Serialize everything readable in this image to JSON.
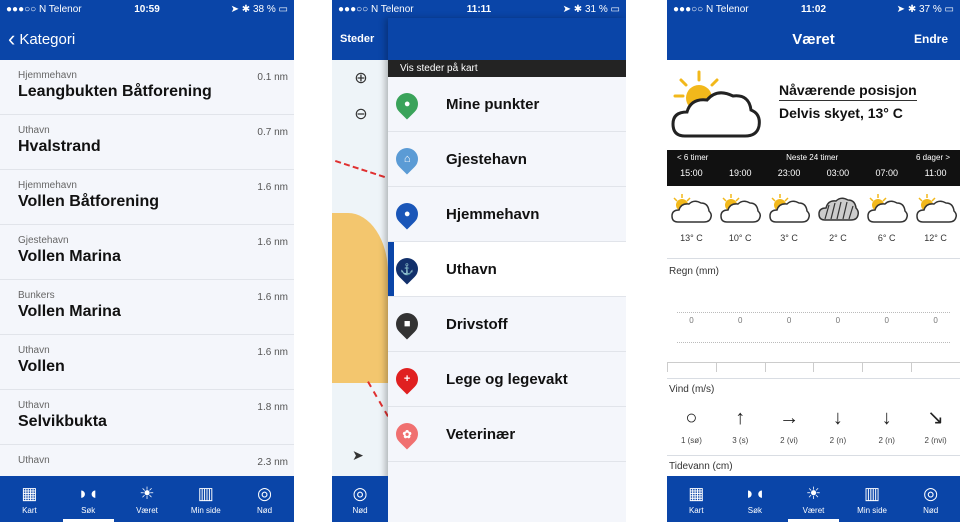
{
  "screen1": {
    "status": {
      "carrier": "●●●○○ N Telenor",
      "time": "10:59",
      "battery": "38 %"
    },
    "back_label": "Kategori",
    "items": [
      {
        "category": "Hjemmehavn",
        "name": "Leangbukten Båtforening",
        "distance": "0.1 nm"
      },
      {
        "category": "Uthavn",
        "name": "Hvalstrand",
        "distance": "0.7 nm"
      },
      {
        "category": "Hjemmehavn",
        "name": "Vollen Båtforening",
        "distance": "1.6 nm"
      },
      {
        "category": "Gjestehavn",
        "name": "Vollen Marina",
        "distance": "1.6 nm"
      },
      {
        "category": "Bunkers",
        "name": "Vollen Marina",
        "distance": "1.6 nm"
      },
      {
        "category": "Uthavn",
        "name": "Vollen",
        "distance": "1.6 nm"
      },
      {
        "category": "Uthavn",
        "name": "Selvikbukta",
        "distance": "1.8 nm"
      },
      {
        "category": "Uthavn",
        "name": "",
        "distance": "2.3 nm"
      }
    ],
    "tabs": [
      "Kart",
      "Søk",
      "Været",
      "Min side",
      "Nød"
    ]
  },
  "screen2": {
    "status": {
      "carrier": "●●●○○ N Telenor",
      "time": "11:11",
      "battery": "31 %"
    },
    "map_title": "Steder",
    "drawer_header": "Vis steder på kart",
    "items": [
      {
        "label": "Mine punkter",
        "color": "#3aa35a",
        "glyph": "●"
      },
      {
        "label": "Gjestehavn",
        "color": "#5b9bd5",
        "glyph": "⌂"
      },
      {
        "label": "Hjemmehavn",
        "color": "#1a56b8",
        "glyph": "●"
      },
      {
        "label": "Uthavn",
        "color": "#12306b",
        "glyph": "⚓"
      },
      {
        "label": "Drivstoff",
        "color": "#333333",
        "glyph": "■"
      },
      {
        "label": "Lege og legevakt",
        "color": "#e02020",
        "glyph": "+"
      },
      {
        "label": "Veterinær",
        "color": "#f07070",
        "glyph": "✿"
      }
    ],
    "tab": "Nød"
  },
  "screen3": {
    "status": {
      "carrier": "●●●○○ N Telenor",
      "time": "11:02",
      "battery": "37 %"
    },
    "title": "Været",
    "edit": "Endre",
    "current": {
      "position": "Nåværende posisjon",
      "condition": "Delvis skyet, 13° C"
    },
    "forecast_nav": {
      "prev": "< 6 timer",
      "center": "Neste 24 timer",
      "next": "6 dager >"
    },
    "times": [
      "15:00",
      "19:00",
      "23:00",
      "03:00",
      "07:00",
      "11:00"
    ],
    "conditions": [
      "partly",
      "partly",
      "partly",
      "rain",
      "partly",
      "partly"
    ],
    "temps": [
      "13° C",
      "10° C",
      "3° C",
      "2° C",
      "6° C",
      "12° C"
    ],
    "rain_label": "Regn (mm)",
    "rain": [
      "0",
      "0",
      "0",
      "0",
      "0",
      "0"
    ],
    "wind_label": "Vind (m/s)",
    "wind_arrows": [
      "○",
      "↑",
      "→",
      "↓",
      "↓",
      "↘"
    ],
    "wind": [
      "1 (sø)",
      "3 (s)",
      "2 (vi)",
      "2 (n)",
      "2 (n)",
      "2 (nvi)"
    ],
    "tide_label": "Tidevann (cm)",
    "tabs": [
      "Kart",
      "Søk",
      "Været",
      "Min side",
      "Nød"
    ]
  }
}
